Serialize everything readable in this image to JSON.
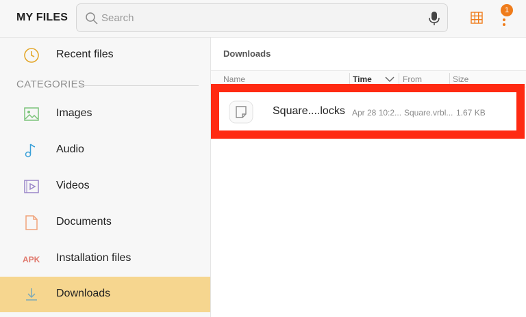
{
  "app": {
    "title": "MY FILES"
  },
  "search": {
    "placeholder": "Search",
    "value": ""
  },
  "header_icons": {
    "grid": "grid-view-icon",
    "more": "more-options-icon",
    "notification_count": "1"
  },
  "colors": {
    "accent": "#ef7c1b",
    "active_item": "#f6d68f",
    "highlight_box": "#ff2a12"
  },
  "sidebar": {
    "recent": {
      "label": "Recent files",
      "icon": "clock-icon"
    },
    "categories_header": "CATEGORIES",
    "items": [
      {
        "label": "Images",
        "icon": "image-icon"
      },
      {
        "label": "Audio",
        "icon": "music-note-icon"
      },
      {
        "label": "Videos",
        "icon": "video-icon"
      },
      {
        "label": "Documents",
        "icon": "document-icon"
      },
      {
        "label": "Installation files",
        "icon": "apk-icon",
        "icon_text": "APK"
      },
      {
        "label": "Downloads",
        "icon": "download-icon",
        "active": true
      }
    ]
  },
  "main": {
    "path": "Downloads",
    "columns": {
      "name": "Name",
      "time": "Time",
      "from": "From",
      "size": "Size"
    },
    "files": [
      {
        "name": "Square....locks",
        "time": "Apr 28 10:2...",
        "from": "Square.vrbl...",
        "size": "1.67 KB"
      }
    ]
  }
}
